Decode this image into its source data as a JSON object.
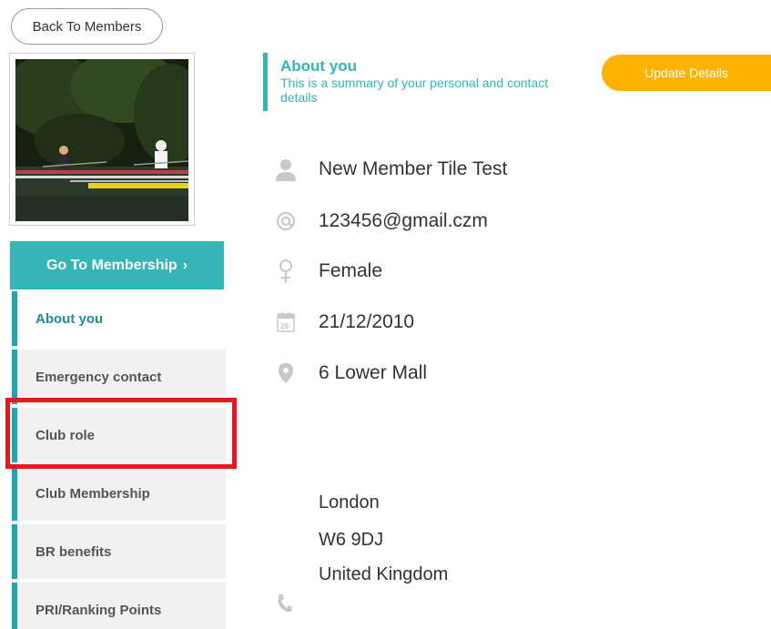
{
  "nav": {
    "back_label": "Back To Members",
    "goto_label": "Go To Membership",
    "goto_chevron": "›"
  },
  "sidebar": {
    "items": [
      {
        "label": "About you",
        "active": true
      },
      {
        "label": "Emergency contact",
        "active": false
      },
      {
        "label": "Club role",
        "active": false
      },
      {
        "label": "Club Membership",
        "active": false
      },
      {
        "label": "BR benefits",
        "active": false
      },
      {
        "label": "PRI/Ranking Points",
        "active": false
      }
    ]
  },
  "section": {
    "title": "About you",
    "subtitle": "This is a summary of your personal and contact details",
    "update_label": "Update Details"
  },
  "details": {
    "name": "New Member Tile Test",
    "email": "123456@gmail.czm",
    "gender": "Female",
    "dob": "21/12/2010",
    "calendar_day": "29",
    "address_line1": "6 Lower Mall",
    "city": "London",
    "postcode": "W6 9DJ",
    "country": "United Kingdom"
  },
  "colors": {
    "accent": "#35b5b5",
    "update_button": "#ffb300",
    "highlight": "#e11b1b",
    "icon": "#c8c8c8"
  },
  "icons": [
    "user-icon",
    "at-icon",
    "female-icon",
    "calendar-icon",
    "location-pin-icon",
    "phone-icon"
  ]
}
